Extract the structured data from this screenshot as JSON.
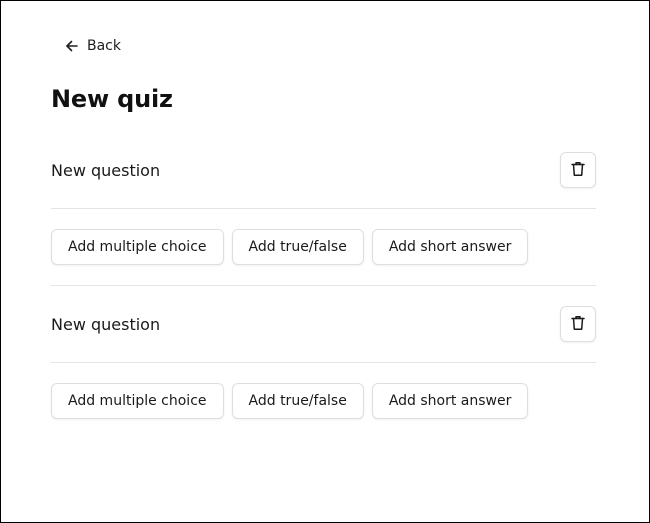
{
  "back": {
    "label": "Back",
    "icon": "arrow-left-icon"
  },
  "page": {
    "title": "New quiz"
  },
  "questions": [
    {
      "title": "New question",
      "delete_icon": "trash-icon",
      "actions": [
        "Add multiple choice",
        "Add true/false",
        "Add short answer"
      ]
    },
    {
      "title": "New question",
      "delete_icon": "trash-icon",
      "actions": [
        "Add multiple choice",
        "Add true/false",
        "Add short answer"
      ]
    }
  ]
}
